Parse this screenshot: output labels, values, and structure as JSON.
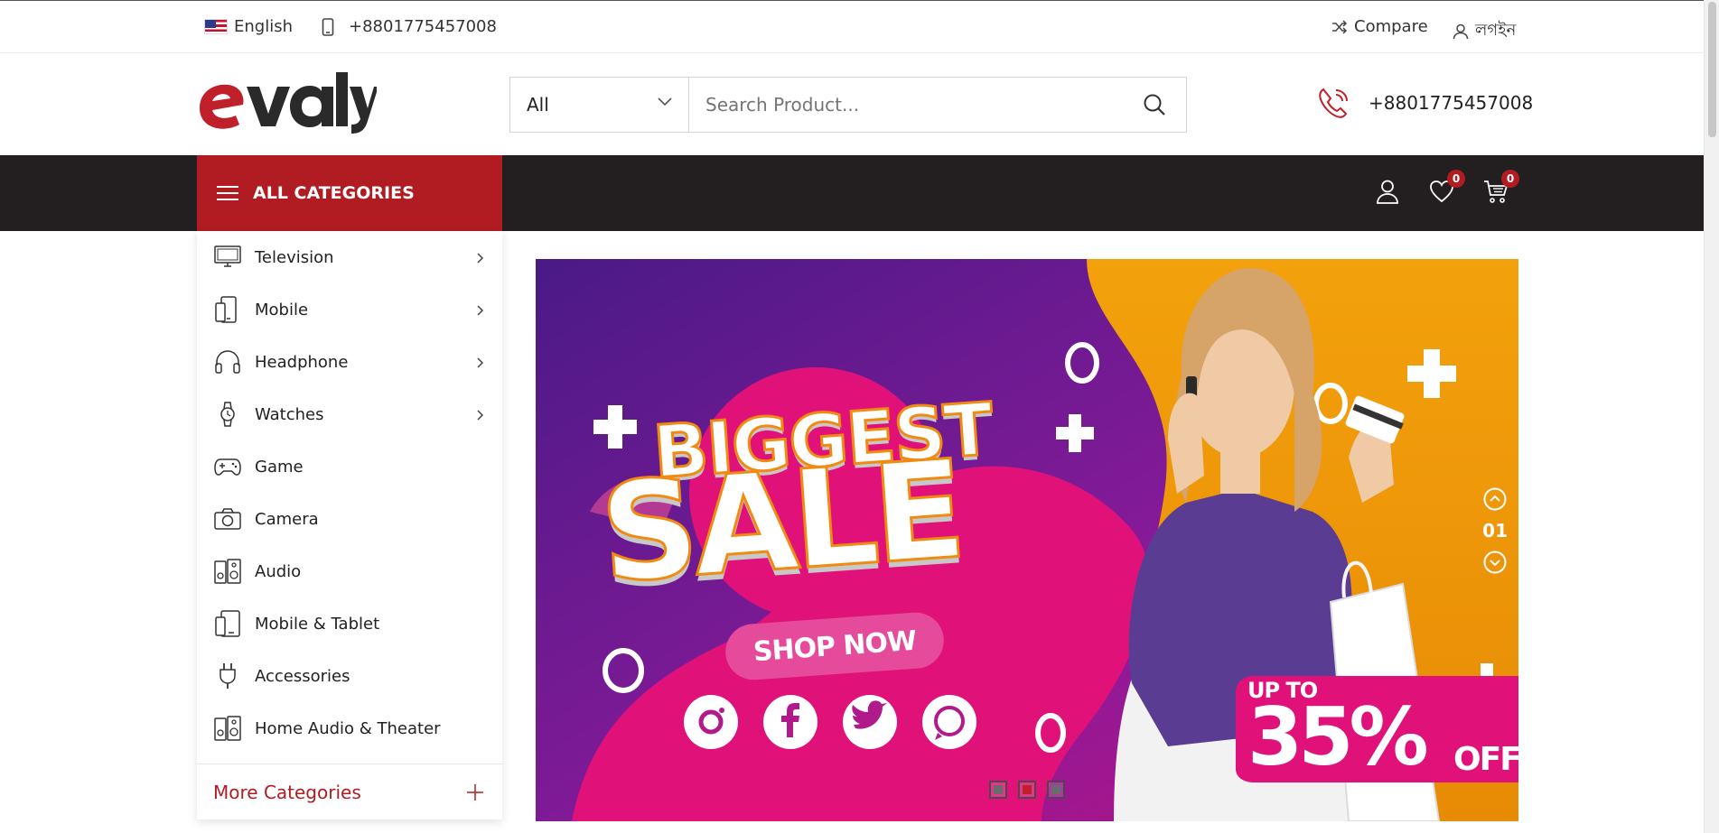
{
  "topbar": {
    "language": "English",
    "phone": "+8801775457008",
    "compare": "Compare",
    "login": "লগইন"
  },
  "header": {
    "logo_text": "evaly",
    "search": {
      "category": "All",
      "placeholder": "Search Product..."
    },
    "phone": "+8801775457008"
  },
  "nav": {
    "all_categories": "ALL CATEGORIES",
    "wishlist_count": "0",
    "cart_count": "0"
  },
  "sidebar": {
    "items": [
      {
        "label": "Television",
        "icon": "television-icon",
        "has_sub": true
      },
      {
        "label": "Mobile",
        "icon": "mobile-icon",
        "has_sub": true
      },
      {
        "label": "Headphone",
        "icon": "headphone-icon",
        "has_sub": true
      },
      {
        "label": "Watches",
        "icon": "watch-icon",
        "has_sub": true
      },
      {
        "label": "Game",
        "icon": "gamepad-icon",
        "has_sub": false
      },
      {
        "label": "Camera",
        "icon": "camera-icon",
        "has_sub": false
      },
      {
        "label": "Audio",
        "icon": "speaker-icon",
        "has_sub": false
      },
      {
        "label": "Mobile & Tablet",
        "icon": "tablet-icon",
        "has_sub": false
      },
      {
        "label": "Accessories",
        "icon": "plug-icon",
        "has_sub": false
      },
      {
        "label": "Home Audio & Theater",
        "icon": "speaker-icon",
        "has_sub": false
      }
    ],
    "more": "More Categories"
  },
  "banner": {
    "line1": "BIGGEST",
    "line2": "SALE",
    "cta": "SHOP NOW",
    "promo_upto": "UP TO",
    "promo_value": "35%",
    "promo_off": "OFF",
    "slide_number": "01",
    "slide_count": 3,
    "active_slide": 2
  },
  "colors": {
    "brand_red": "#b01c21",
    "nav_dark": "#231f20",
    "banner_purple": "#5a1c8c",
    "banner_pink": "#e0127a",
    "banner_orange": "#f5a20a"
  }
}
